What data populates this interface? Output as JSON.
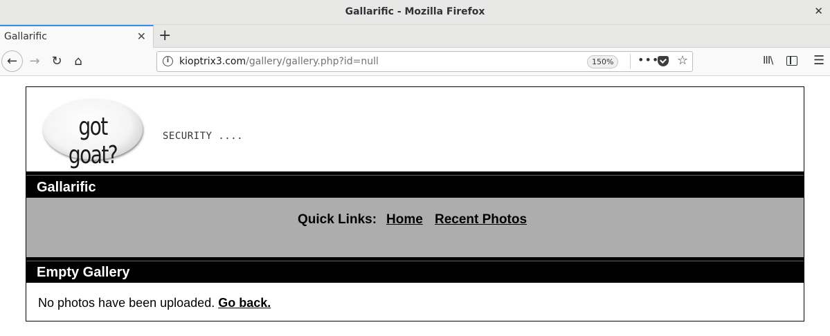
{
  "window": {
    "title": "Gallarific - Mozilla Firefox",
    "close_glyph": "✕"
  },
  "tabs": [
    {
      "label": "Gallarific",
      "close_glyph": "✕"
    }
  ],
  "toolbar": {
    "new_tab_glyph": "+",
    "back_glyph": "←",
    "forward_glyph": "→",
    "reload_glyph": "↻",
    "home_glyph": "⌂",
    "url_host": "kioptrix3.com",
    "url_path": "/gallery/gallery.php?id=null",
    "zoom": "150%",
    "more_glyph": "•••",
    "star_glyph": "☆",
    "library_glyph": "III\\",
    "menu_glyph": "☰"
  },
  "page": {
    "logo_text": "got goat?",
    "slogan": "SECURITY ....",
    "site_title": "Gallarific",
    "quick_links_label": "Quick Links:",
    "links": {
      "home": "Home",
      "recent": "Recent Photos"
    },
    "section_title": "Empty Gallery",
    "message": "No photos have been uploaded. ",
    "go_back": "Go back."
  },
  "colors": {
    "band_bg": "#000000",
    "links_bg": "#aeadad",
    "tab_accent": "#3a8ee6"
  },
  "icons": [
    "close-icon",
    "back-icon",
    "forward-icon",
    "reload-icon",
    "home-icon",
    "info-icon",
    "more-icon",
    "pocket-icon",
    "star-icon",
    "library-icon",
    "sidebar-icon",
    "menu-icon"
  ]
}
